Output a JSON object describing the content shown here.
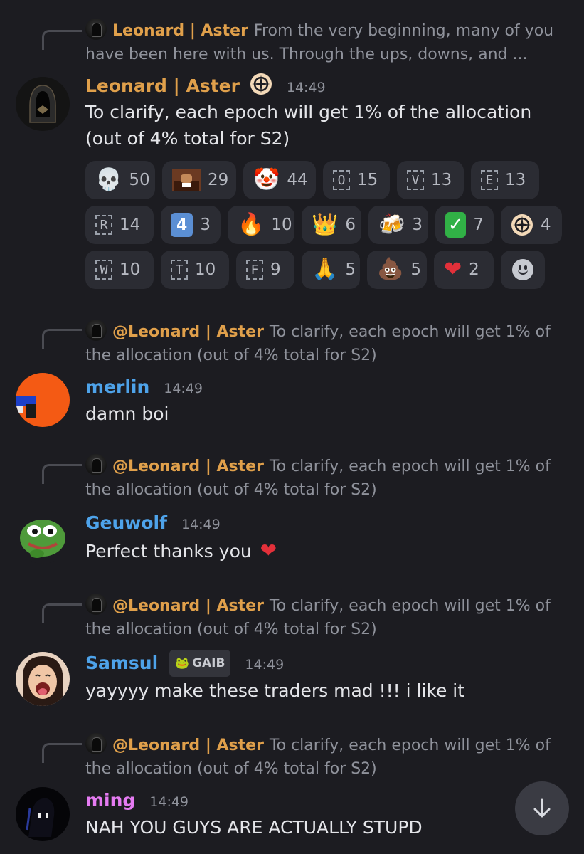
{
  "colors": {
    "background": "#1c1c21",
    "leonard_name": "#e0a04b",
    "merlin_name": "#4ea3ea",
    "geuwolf_name": "#4ea3ea",
    "samsul_name": "#4ea3ea",
    "ming_name": "#e57bf2",
    "reaction_bg": "#2b2c33"
  },
  "messages": [
    {
      "reply": {
        "author": "Leonard | Aster",
        "text": "From the very beginning, many of you have been here with us. Through the ups, downs, and ..."
      },
      "author": "Leonard | Aster",
      "badge_icon": "aster-logo-icon",
      "time": "14:49",
      "text": "To clarify, each epoch will get 1% of the allocation (out of 4% total for S2)",
      "reactions": [
        {
          "icon": "skull-icon",
          "count": "50"
        },
        {
          "icon": "meme-face-icon",
          "count": "29"
        },
        {
          "icon": "clown-icon",
          "count": "44"
        },
        {
          "icon": "letter-o-icon",
          "letter": "O",
          "count": "15"
        },
        {
          "icon": "letter-v-icon",
          "letter": "V",
          "count": "13"
        },
        {
          "icon": "letter-e-icon",
          "letter": "E",
          "count": "13"
        },
        {
          "icon": "letter-r-icon",
          "letter": "R",
          "count": "14"
        },
        {
          "icon": "keycap-4-icon",
          "letter": "4",
          "count": "3"
        },
        {
          "icon": "fire-icon",
          "count": "10"
        },
        {
          "icon": "crown-icon",
          "count": "6"
        },
        {
          "icon": "beer-mugs-icon",
          "count": "3"
        },
        {
          "icon": "check-mark-icon",
          "count": "7"
        },
        {
          "icon": "aster-logo-icon",
          "count": "4"
        },
        {
          "icon": "letter-w-icon",
          "letter": "W",
          "count": "10"
        },
        {
          "icon": "letter-t-icon",
          "letter": "T",
          "count": "10"
        },
        {
          "icon": "letter-f-icon",
          "letter": "F",
          "count": "9"
        },
        {
          "icon": "praying-hands-icon",
          "count": "5"
        },
        {
          "icon": "poop-icon",
          "count": "5"
        },
        {
          "icon": "heart-icon",
          "count": "2"
        }
      ]
    },
    {
      "reply": {
        "author": "@Leonard | Aster",
        "text": "To clarify, each epoch will get 1% of the allocation (out of 4% total for S2)"
      },
      "author": "merlin",
      "time": "14:49",
      "text": "damn boi"
    },
    {
      "reply": {
        "author": "@Leonard | Aster",
        "text": "To clarify, each epoch will get 1% of the allocation (out of 4% total for S2)"
      },
      "author": "Geuwolf",
      "time": "14:49",
      "text": "Perfect thanks you"
    },
    {
      "reply": {
        "author": "@Leonard | Aster",
        "text": "To clarify, each epoch will get 1% of the allocation (out of 4% total for S2)"
      },
      "author": "Samsul",
      "tag": "GAIB",
      "time": "14:49",
      "text": "yayyyy make these traders mad !!! i like it"
    },
    {
      "reply": {
        "author": "@Leonard | Aster",
        "text": "To clarify, each epoch will get 1% of the allocation (out of 4% total for S2)"
      },
      "author": "ming",
      "time": "14:49",
      "text": "NAH YOU GUYS ARE ACTUALLY STUPD"
    }
  ],
  "scroll_button_icon": "arrow-down-icon"
}
